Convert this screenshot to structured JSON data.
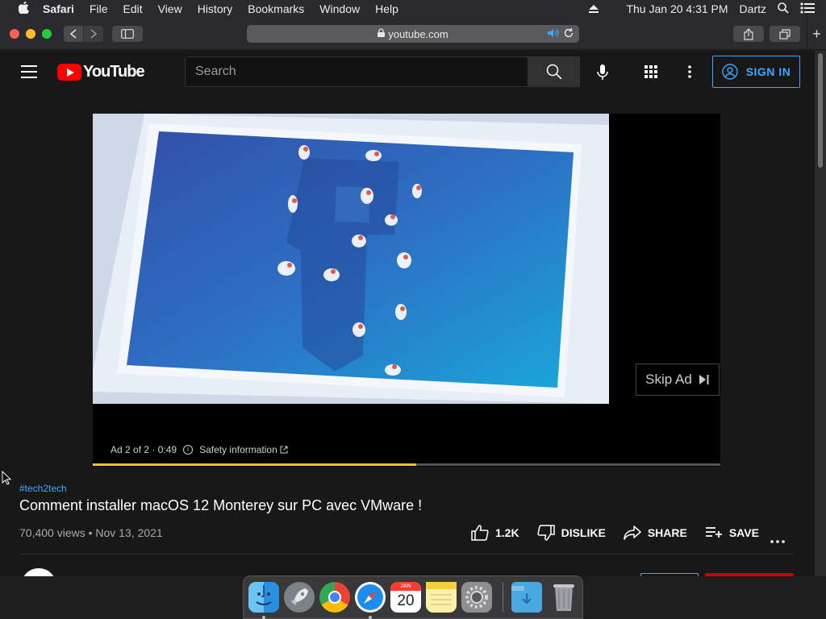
{
  "menubar": {
    "app": "Safari",
    "items": [
      "File",
      "Edit",
      "View",
      "History",
      "Bookmarks",
      "Window",
      "Help"
    ],
    "datetime": "Thu Jan 20  4:31 PM",
    "user": "Dartz"
  },
  "browser": {
    "url": "youtube.com"
  },
  "youtube": {
    "logo_text": "YouTube",
    "search_placeholder": "Search",
    "signin_label": "SIGN IN"
  },
  "player": {
    "skip_label": "Skip Ad",
    "ad_counter": "Ad 2 of 2 · 0:49",
    "safety_label": "Safety information",
    "ad_progress": 0.515,
    "accent_color": "#f2c12e"
  },
  "video": {
    "hashtag": "#tech2tech",
    "title": "Comment installer macOS 12 Monterey sur PC avec VMware !",
    "meta": "70,400 views • Nov 13, 2021",
    "like_count": "1.2K",
    "dislike_label": "DISLIKE",
    "share_label": "SHARE",
    "save_label": "SAVE"
  },
  "dock": {
    "items": [
      "finder-icon",
      "launchpad-icon",
      "chrome-icon",
      "safari-icon",
      "calendar-icon",
      "notes-icon",
      "system-preferences-icon",
      "downloads-folder-icon",
      "trash-icon"
    ],
    "calendar_month": "JAN",
    "calendar_day": "20"
  }
}
